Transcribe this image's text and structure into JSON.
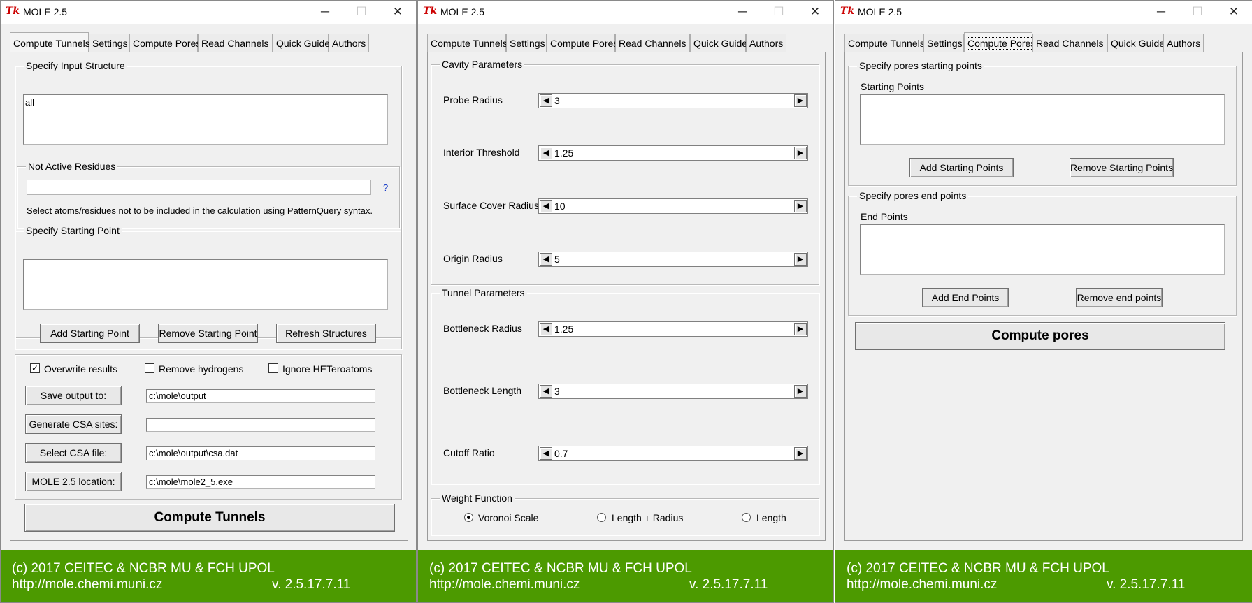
{
  "window_title": "MOLE 2.5",
  "logo_text": "Tk",
  "window_controls": {
    "minimize": "─",
    "maximize": "☐",
    "close": "✕"
  },
  "tabs": [
    "Compute Tunnels",
    "Settings",
    "Compute Pores",
    "Read Channels",
    "Quick Guide",
    "Authors"
  ],
  "compute_tunnels": {
    "input_structure": {
      "title": "Specify Input Structure",
      "value": "all"
    },
    "not_active": {
      "title": "Not Active Residues",
      "value": "",
      "help": "?",
      "hint": "Select atoms/residues not to be included in the calculation using PatternQuery syntax."
    },
    "starting_point": {
      "title": "Specify Starting Point",
      "value": "",
      "add_btn": "Add Starting Point",
      "remove_btn": "Remove Starting Point",
      "refresh_btn": "Refresh Structures"
    },
    "options": {
      "overwrite": {
        "label": "Overwrite results",
        "checked": true,
        "mark": "✓"
      },
      "remove_h": {
        "label": "Remove hydrogens",
        "checked": false
      },
      "ignore_het": {
        "label": "Ignore HETeroatoms",
        "checked": false
      }
    },
    "save_output": {
      "btn": "Save output to:",
      "value": "c:\\mole\\output"
    },
    "csa_sites": {
      "btn": "Generate CSA sites:",
      "value": ""
    },
    "csa_file": {
      "btn": "Select CSA file:",
      "value": "c:\\mole\\output\\csa.dat"
    },
    "mole_location": {
      "btn": "MOLE 2.5 location:",
      "value": "c:\\mole\\mole2_5.exe"
    },
    "compute_btn": "Compute Tunnels"
  },
  "settings": {
    "cavity_title": "Cavity Parameters",
    "probe_radius": {
      "label": "Probe Radius",
      "value": "3"
    },
    "interior_threshold": {
      "label": "Interior Threshold",
      "value": "1.25"
    },
    "surface_cover_radius": {
      "label": "Surface Cover Radius",
      "value": "10"
    },
    "origin_radius": {
      "label": "Origin Radius",
      "value": "5"
    },
    "tunnel_title": "Tunnel Parameters",
    "bottleneck_radius": {
      "label": "Bottleneck Radius",
      "value": "1.25"
    },
    "bottleneck_length": {
      "label": "Bottleneck Length",
      "value": "3"
    },
    "cutoff_ratio": {
      "label": "Cutoff Ratio",
      "value": "0.7"
    },
    "weight_title": "Weight Function",
    "weight_options": [
      "Voronoi Scale",
      "Length + Radius",
      "Length"
    ],
    "weight_selected": "Voronoi Scale",
    "arrow_left": "◀",
    "arrow_right": "▶"
  },
  "compute_pores": {
    "start_title": "Specify pores starting points",
    "start_label": "Starting Points",
    "start_value": "",
    "add_start_btn": "Add Starting Points",
    "remove_start_btn": "Remove Starting Points",
    "end_title": "Specify pores end points",
    "end_label": "End Points",
    "end_value": "",
    "add_end_btn": "Add End Points",
    "remove_end_btn": "Remove end points",
    "compute_btn": "Compute pores"
  },
  "footer": {
    "line1": "(c) 2017 CEITEC & NCBR MU & FCH UPOL",
    "url": "http://mole.chemi.muni.cz",
    "version": "v. 2.5.17.7.11",
    "color": "#4c9a00"
  }
}
